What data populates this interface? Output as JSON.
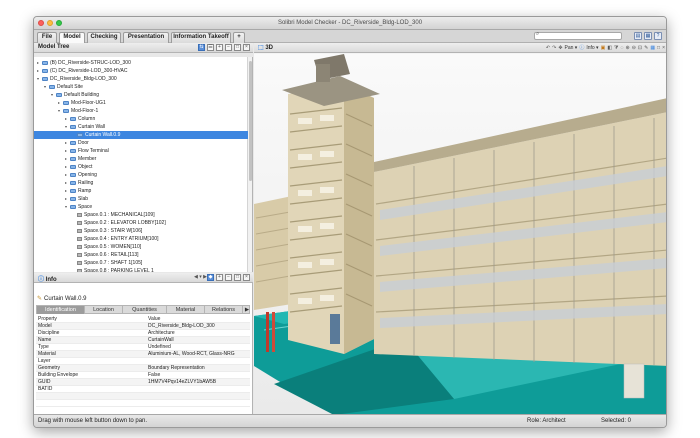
{
  "window": {
    "title": "Solibri Model Checker - DC_Riverside_Bldg-LOD_300"
  },
  "menubar": {
    "tabs": [
      "File",
      "Model",
      "Checking",
      "Presentation",
      "Information Takeoff",
      "+"
    ],
    "active_tab": "Model"
  },
  "model_tree": {
    "title": "Model Tree",
    "items": [
      {
        "label": "(B) DC_Riverside-STRUC-LOD_300",
        "depth": 0,
        "expander": "▸",
        "kind": "model"
      },
      {
        "label": "(C) DC_Riverside-LOD_300-HVAC",
        "depth": 0,
        "expander": "▸",
        "kind": "model"
      },
      {
        "label": "DC_Riverside_Bldg-LOD_300",
        "depth": 0,
        "expander": "▾",
        "kind": "model"
      },
      {
        "label": "Default Site",
        "depth": 1,
        "expander": "▾",
        "kind": "folder"
      },
      {
        "label": "Default Building",
        "depth": 2,
        "expander": "▾",
        "kind": "folder"
      },
      {
        "label": "Mod-Floor-UG1",
        "depth": 3,
        "expander": "▸",
        "kind": "folder"
      },
      {
        "label": "Mod-Floor-1",
        "depth": 3,
        "expander": "▾",
        "kind": "folder"
      },
      {
        "label": "Column",
        "depth": 4,
        "expander": "▸",
        "kind": "folder"
      },
      {
        "label": "Curtain Wall",
        "depth": 4,
        "expander": "▾",
        "kind": "folder"
      },
      {
        "label": "Curtain Wall.0.9",
        "depth": 5,
        "expander": "",
        "kind": "item",
        "selected": true
      },
      {
        "label": "Door",
        "depth": 4,
        "expander": "▸",
        "kind": "folder"
      },
      {
        "label": "Flow Terminal",
        "depth": 4,
        "expander": "▸",
        "kind": "folder"
      },
      {
        "label": "Member",
        "depth": 4,
        "expander": "▸",
        "kind": "folder"
      },
      {
        "label": "Object",
        "depth": 4,
        "expander": "▸",
        "kind": "folder"
      },
      {
        "label": "Opening",
        "depth": 4,
        "expander": "▸",
        "kind": "folder"
      },
      {
        "label": "Railing",
        "depth": 4,
        "expander": "▸",
        "kind": "folder"
      },
      {
        "label": "Ramp",
        "depth": 4,
        "expander": "▸",
        "kind": "folder"
      },
      {
        "label": "Slab",
        "depth": 4,
        "expander": "▸",
        "kind": "folder"
      },
      {
        "label": "Space",
        "depth": 4,
        "expander": "▾",
        "kind": "folder"
      },
      {
        "label": "Space.0.1 : MECHANICAL[109]",
        "depth": 5,
        "expander": "",
        "kind": "space"
      },
      {
        "label": "Space.0.2 : ELEVATOR LOBBY[102]",
        "depth": 5,
        "expander": "",
        "kind": "space"
      },
      {
        "label": "Space.0.3 : STAIR W[106]",
        "depth": 5,
        "expander": "",
        "kind": "space"
      },
      {
        "label": "Space.0.4 : ENTRY ATRIUM[100]",
        "depth": 5,
        "expander": "",
        "kind": "space"
      },
      {
        "label": "Space.0.5 : WOMEN[110]",
        "depth": 5,
        "expander": "",
        "kind": "space"
      },
      {
        "label": "Space.0.6 : RETAIL[113]",
        "depth": 5,
        "expander": "",
        "kind": "space"
      },
      {
        "label": "Space.0.7 : SHAFT 1[105]",
        "depth": 5,
        "expander": "",
        "kind": "space"
      },
      {
        "label": "Space.0.8 : PARKING LEVEL 1",
        "depth": 5,
        "expander": "",
        "kind": "space"
      },
      {
        "label": "Space.0.9 : MEN[111]",
        "depth": 5,
        "expander": "",
        "kind": "space"
      },
      {
        "label": "Space.0.10 : SHAFT 1[107]",
        "depth": 5,
        "expander": "",
        "kind": "space"
      }
    ]
  },
  "info": {
    "title": "Info",
    "object_name": "Curtain Wall.0.9",
    "tabs": [
      "Identification",
      "Location",
      "Quantities",
      "Material",
      "Relations",
      "▶"
    ],
    "active_tab": "Identification",
    "header": {
      "key": "Property",
      "value": "Value"
    },
    "rows": [
      {
        "key": "Model",
        "value": "DC_Riverside_Bldg-LOD_300"
      },
      {
        "key": "Discipline",
        "value": "Architecture"
      },
      {
        "key": "Name",
        "value": "CurtainWall"
      },
      {
        "key": "Type",
        "value": "Undefined"
      },
      {
        "key": "Material",
        "value": "Aluminium-AL, Wood-RCT, Glass-NRG"
      },
      {
        "key": "Layer",
        "value": ""
      },
      {
        "key": "Geometry",
        "value": "Boundary Representation"
      },
      {
        "key": "Building Envelope",
        "value": "False"
      },
      {
        "key": "GUID",
        "value": "1HM7V4Pqv14eZLVY1bAW5B"
      },
      {
        "key": "BATID",
        "value": ""
      }
    ]
  },
  "view3d": {
    "title": "3D",
    "tools": [
      "Pan ▾",
      "Info ▾"
    ]
  },
  "status": {
    "message": "Drag with mouse left button down to pan.",
    "role": "Role: Architect",
    "selected": "Selected: 0"
  },
  "colors": {
    "accent": "#3d86e0",
    "building_cream": "#ddd2b4",
    "podium_teal": "#11a7a3"
  },
  "icons": [
    "search-icon",
    "folder-icon",
    "space-icon",
    "info-icon",
    "pencil-icon",
    "pan-icon",
    "zoom-icon"
  ]
}
